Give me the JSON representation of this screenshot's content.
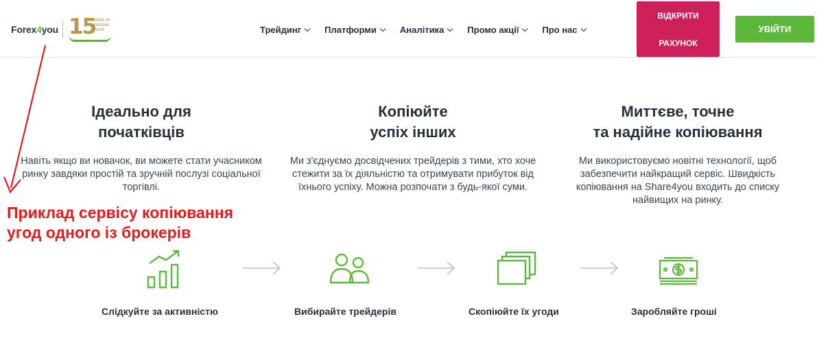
{
  "header": {
    "logo": {
      "brand_a": "Forex",
      "brand_b": "4",
      "brand_c": "you",
      "anniv_number": "15",
      "anniv_line1": "YEARS OF",
      "anniv_line2": "BUILDING",
      "anniv_line3": "TRUST"
    },
    "nav": [
      "Трейдинг",
      "Платформи",
      "Аналітика",
      "Промо акції",
      "Про нас"
    ],
    "open_account_line1": "ВІДКРИТИ",
    "open_account_line2": "РАХУНОК",
    "login": "УВІЙТИ"
  },
  "features": [
    {
      "title_line1": "Ідеально для",
      "title_line2": "початківців",
      "text": "Навіть якщо ви новачок, ви можете стати учасником ринку завдяки простій та зручній послузі соціальної торгівлі."
    },
    {
      "title_line1": "Копіюйте",
      "title_line2": "успіх інших",
      "text": "Ми з'єднуємо досвідчених трейдерів з тими, хто хоче стежити за їх діяльністю та отримувати прибуток від їхнього успіху. Можна розпочати з будь-якої суми."
    },
    {
      "title_line1": "Миттєве, точне",
      "title_line2": "та надійне копіювання",
      "text": "Ми використовуємо новітні технології, щоб забезпечити найкращий сервіс. Швидкість копіювання на Share4you входить до списку найвищих на ринку."
    }
  ],
  "annotation": {
    "line1": "Приклад сервісу копіювання",
    "line2": "угод одного із брокерів"
  },
  "steps": [
    {
      "label": "Слідкуйте за активністю",
      "icon": "growth-chart-icon"
    },
    {
      "label": "Вибирайте трейдерів",
      "icon": "users-icon"
    },
    {
      "label": "Скопіюйте їх угоди",
      "icon": "copy-windows-icon"
    },
    {
      "label": "Заробляйте гроші",
      "icon": "money-stack-icon"
    }
  ],
  "colors": {
    "accent_green": "#5cb83a",
    "accent_red": "#cd1f5a",
    "annotation_red": "#e21b1b",
    "arrow_gray": "#b9c1c8"
  }
}
